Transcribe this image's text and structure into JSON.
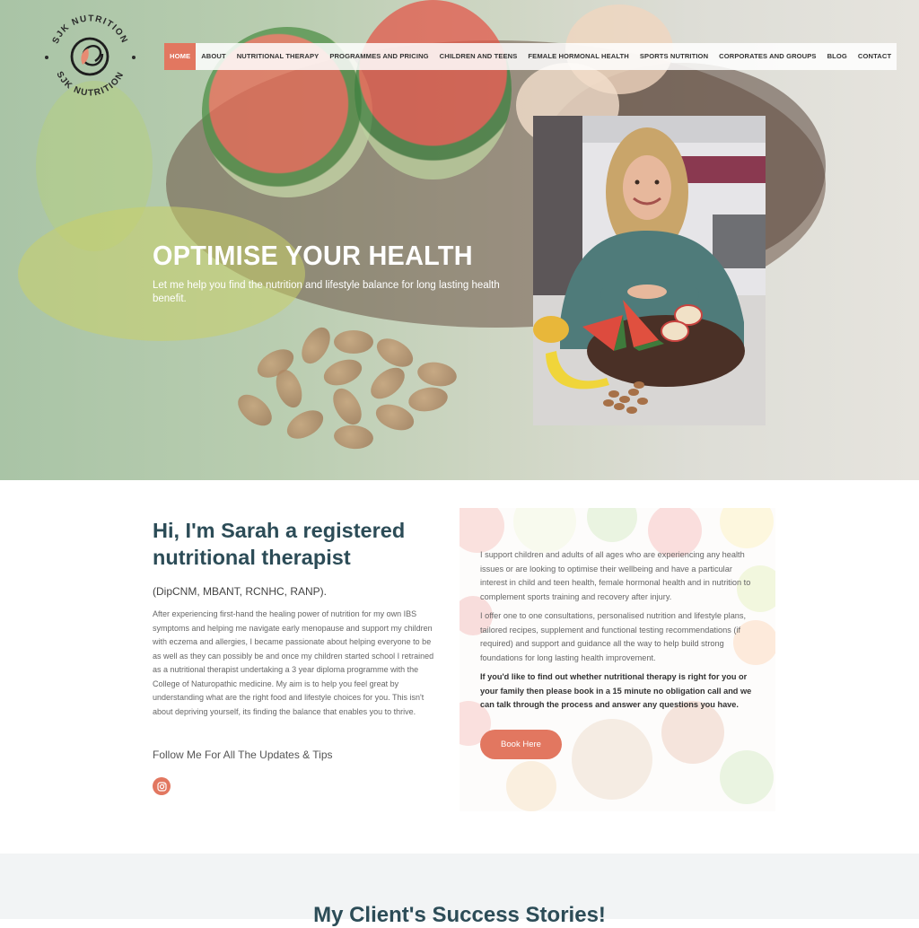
{
  "brand": {
    "logo_text_top": "SJK NUTRITION",
    "logo_text_bottom": "SJK NUTRITION",
    "accent": "#e27760",
    "heading_color": "#2c4c57"
  },
  "nav": {
    "items": [
      {
        "label": "HOME",
        "active": true
      },
      {
        "label": "ABOUT"
      },
      {
        "label": "NUTRITIONAL THERAPY"
      },
      {
        "label": "PROGRAMMES AND PRICING"
      },
      {
        "label": "CHILDREN AND TEENS"
      },
      {
        "label": "FEMALE HORMONAL HEALTH"
      },
      {
        "label": "SPORTS NUTRITION"
      },
      {
        "label": "CORPORATES AND GROUPS"
      },
      {
        "label": "BLOG"
      },
      {
        "label": "CONTACT"
      }
    ]
  },
  "hero": {
    "title": "OPTIMISE YOUR HEALTH",
    "subtitle": "Let me help you find the nutrition and lifestyle balance for long lasting health benefit."
  },
  "about": {
    "heading": "Hi, I'm Sarah a registered nutritional therapist",
    "credentials": "(DipCNM, MBANT, RCNHC, RANP).",
    "paragraph": "After experiencing first-hand the healing power of nutrition for my own IBS symptoms and helping me navigate early menopause and support my children with eczema and allergies, I became passionate about helping everyone to be as well as they can possibly be and once my children started school I retrained as a nutritional therapist undertaking a 3 year diploma programme with the College of Naturopathic medicine. My aim is to help you feel great by understanding what are the right food and lifestyle choices for you. This isn't about depriving yourself, its finding the balance that enables you to thrive.",
    "follow_label": "Follow Me For All The Updates & Tips",
    "social_icon": "instagram-icon"
  },
  "services": {
    "p1": "I support children and adults of all ages who are experiencing any health issues or are looking to optimise their wellbeing and have a particular interest in child and teen health, female hormonal health and in nutrition to complement sports training and recovery after injury.",
    "p2": "I offer one to one consultations, personalised nutrition and lifestyle plans, tailored recipes, supplement and functional testing recommendations (if required) and support and guidance all the way to help build strong foundations for long lasting health improvement.",
    "p3": "If you'd like to find out whether nutritional therapy is right for you or your family  then please book in a 15 minute no obligation call and we can talk through the process and answer any questions you have.",
    "button_label": "Book Here"
  },
  "testimonials": {
    "heading": "My Client's Success Stories!"
  }
}
